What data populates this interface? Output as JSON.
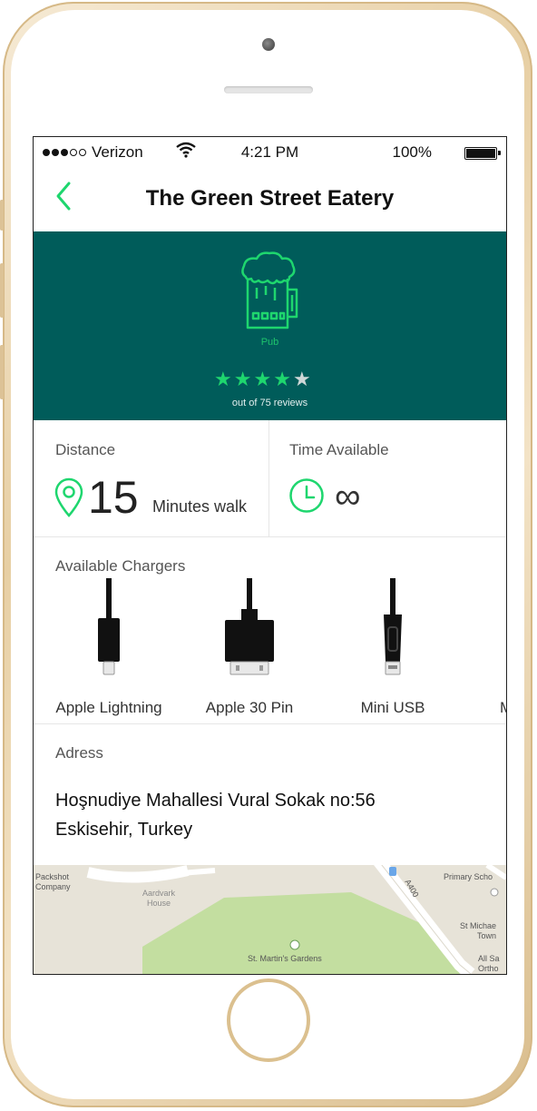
{
  "status_bar": {
    "carrier": "Verizon",
    "time": "4:21 PM",
    "battery": "100%"
  },
  "nav": {
    "title": "The Green Street Eatery",
    "back_icon": "chevron-left-icon"
  },
  "venue": {
    "category": "Pub",
    "category_icon": "beer-mug-icon",
    "rating": 4,
    "rating_max": 5,
    "reviews_text": "out of 75 reviews"
  },
  "distance": {
    "label": "Distance",
    "value": "15",
    "unit": "Minutes walk"
  },
  "time_available": {
    "label": "Time Available",
    "value": "∞"
  },
  "chargers": {
    "label": "Available Chargers",
    "items": [
      {
        "name": "Apple Lightning",
        "icon": "lightning-cable-icon"
      },
      {
        "name": "Apple 30 Pin",
        "icon": "30-pin-cable-icon"
      },
      {
        "name": "Mini USB",
        "icon": "mini-usb-cable-icon"
      }
    ],
    "partial_next": "M"
  },
  "address": {
    "label": "Adress",
    "line1": "Hoşnudiye Mahallesi Vural Sokak no:56",
    "line2": "Eskisehir, Turkey"
  },
  "map": {
    "labels": {
      "packshot": "Packshot\nCompany",
      "aardvark": "Aardvark\nHouse",
      "road": "A400",
      "primary": "Primary Scho",
      "st_michael": "St Michae\nTown",
      "gardens": "St. Martin's Gardens",
      "all_saints": "All Sa\nOrtho"
    }
  },
  "colors": {
    "accent": "#1ed66e",
    "hero_bg": "#005c5a",
    "phone_gold": "#e7cfa4"
  }
}
